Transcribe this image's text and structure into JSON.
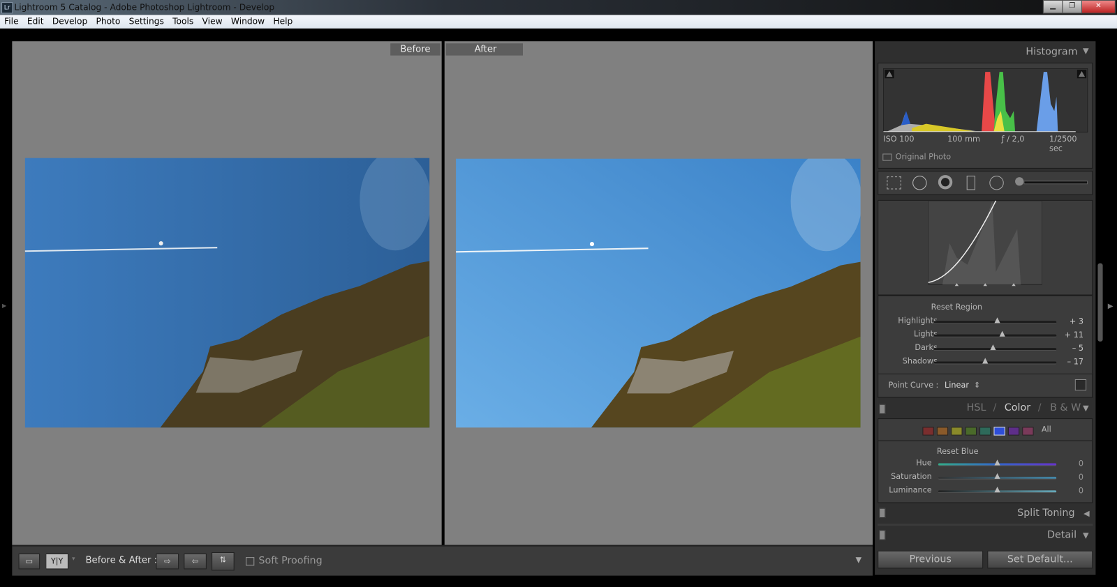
{
  "window": {
    "title": "Lightroom 5 Catalog - Adobe Photoshop Lightroom - Develop",
    "app_icon": "Lr",
    "minimize": "▁",
    "maximize": "❐",
    "close": "✕"
  },
  "menu": [
    "File",
    "Edit",
    "Develop",
    "Photo",
    "Settings",
    "Tools",
    "View",
    "Window",
    "Help"
  ],
  "view": {
    "before_label": "Before",
    "after_label": "After"
  },
  "toolbar": {
    "loupe_icon": "▭",
    "yy_label": "Y|Y",
    "before_after_label": "Before & After :",
    "copy_before_to_after": "⇨",
    "copy_after_to_before": "⇦",
    "swap": "⇅",
    "soft_proofing": "Soft Proofing"
  },
  "histogram": {
    "title": "Histogram",
    "iso": "ISO 100",
    "focal": "100 mm",
    "aperture": "ƒ / 2,0",
    "shutter": "1/2500 sec",
    "original_photo": "Original Photo"
  },
  "tone_curve": {
    "reset_label": "Reset Region",
    "sliders": [
      {
        "label": "Highlights",
        "value": "+ 3",
        "pos": 0.52
      },
      {
        "label": "Lights",
        "value": "+ 11",
        "pos": 0.56
      },
      {
        "label": "Darks",
        "value": "– 5",
        "pos": 0.48
      },
      {
        "label": "Shadows",
        "value": "– 17",
        "pos": 0.42
      }
    ],
    "point_curve_label": "Point Curve :",
    "point_curve_value": "Linear"
  },
  "hsl": {
    "tabs": [
      "HSL",
      "Color",
      "B & W"
    ],
    "active": "Color",
    "separator": "/",
    "all_label": "All",
    "swatches": [
      "#7a2e2e",
      "#8a5a2a",
      "#8a8a2a",
      "#4a6a2a",
      "#2e6a5a",
      "#2e4ed8",
      "#5e2e8a",
      "#7a3a5a"
    ],
    "reset_label": "Reset Blue",
    "sliders": [
      {
        "label": "Hue",
        "value": "0",
        "pos": 0.5
      },
      {
        "label": "Saturation",
        "value": "0",
        "pos": 0.5
      },
      {
        "label": "Luminance",
        "value": "0",
        "pos": 0.5
      }
    ]
  },
  "sections": {
    "split_toning": "Split Toning",
    "detail": "Detail"
  },
  "buttons": {
    "previous": "Previous",
    "set_default": "Set Default..."
  }
}
